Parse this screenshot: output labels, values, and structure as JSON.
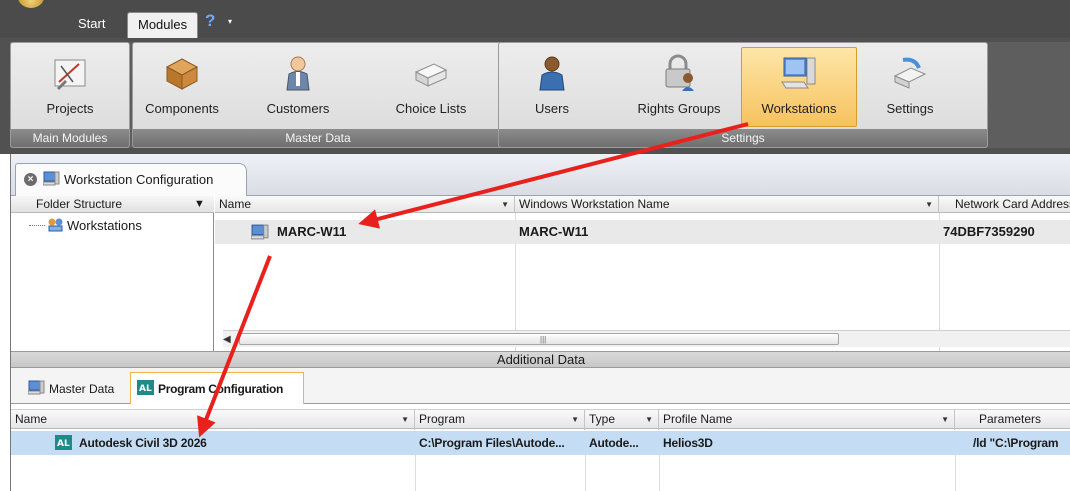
{
  "tabs": {
    "start": "Start",
    "modules": "Modules",
    "help": "?",
    "dropdown": "▾"
  },
  "ribbon": {
    "groups": {
      "main_modules": "Main Modules",
      "master_data": "Master Data",
      "settings": "Settings"
    },
    "buttons": {
      "projects": "Projects",
      "components": "Components",
      "customers": "Customers",
      "choice_lists": "Choice Lists",
      "users": "Users",
      "rights_groups": "Rights Groups",
      "workstations": "Workstations",
      "settings": "Settings"
    },
    "selected": "Workstations"
  },
  "document_tab": {
    "title": "Workstation Configuration"
  },
  "folder_structure": {
    "header": "Folder Structure",
    "nodes": [
      "Workstations"
    ]
  },
  "workstation_grid": {
    "columns": [
      "Name",
      "Windows Workstation Name",
      "Network Card Address"
    ],
    "rows": [
      {
        "name": "MARC-W11",
        "windows_name": "MARC-W11",
        "network_card": "74DBF7359290"
      }
    ]
  },
  "additional_data": {
    "header": "Additional Data",
    "tabs": [
      "Master Data",
      "Program Configuration"
    ],
    "active_tab": "Program Configuration"
  },
  "program_grid": {
    "columns": [
      "Name",
      "Program",
      "Type",
      "Profile Name",
      "Parameters"
    ],
    "rows": [
      {
        "name": "Autodesk Civil 3D 2026",
        "program": "C:\\Program Files\\Autode...",
        "type": "Autode...",
        "profile": "Helios3D",
        "parameters": "/ld \"C:\\Program"
      }
    ]
  },
  "colors": {
    "ribbon_selected": "#f7c25e",
    "row_selected": "#c4ddf5",
    "annotation_arrow": "#e8211c"
  }
}
